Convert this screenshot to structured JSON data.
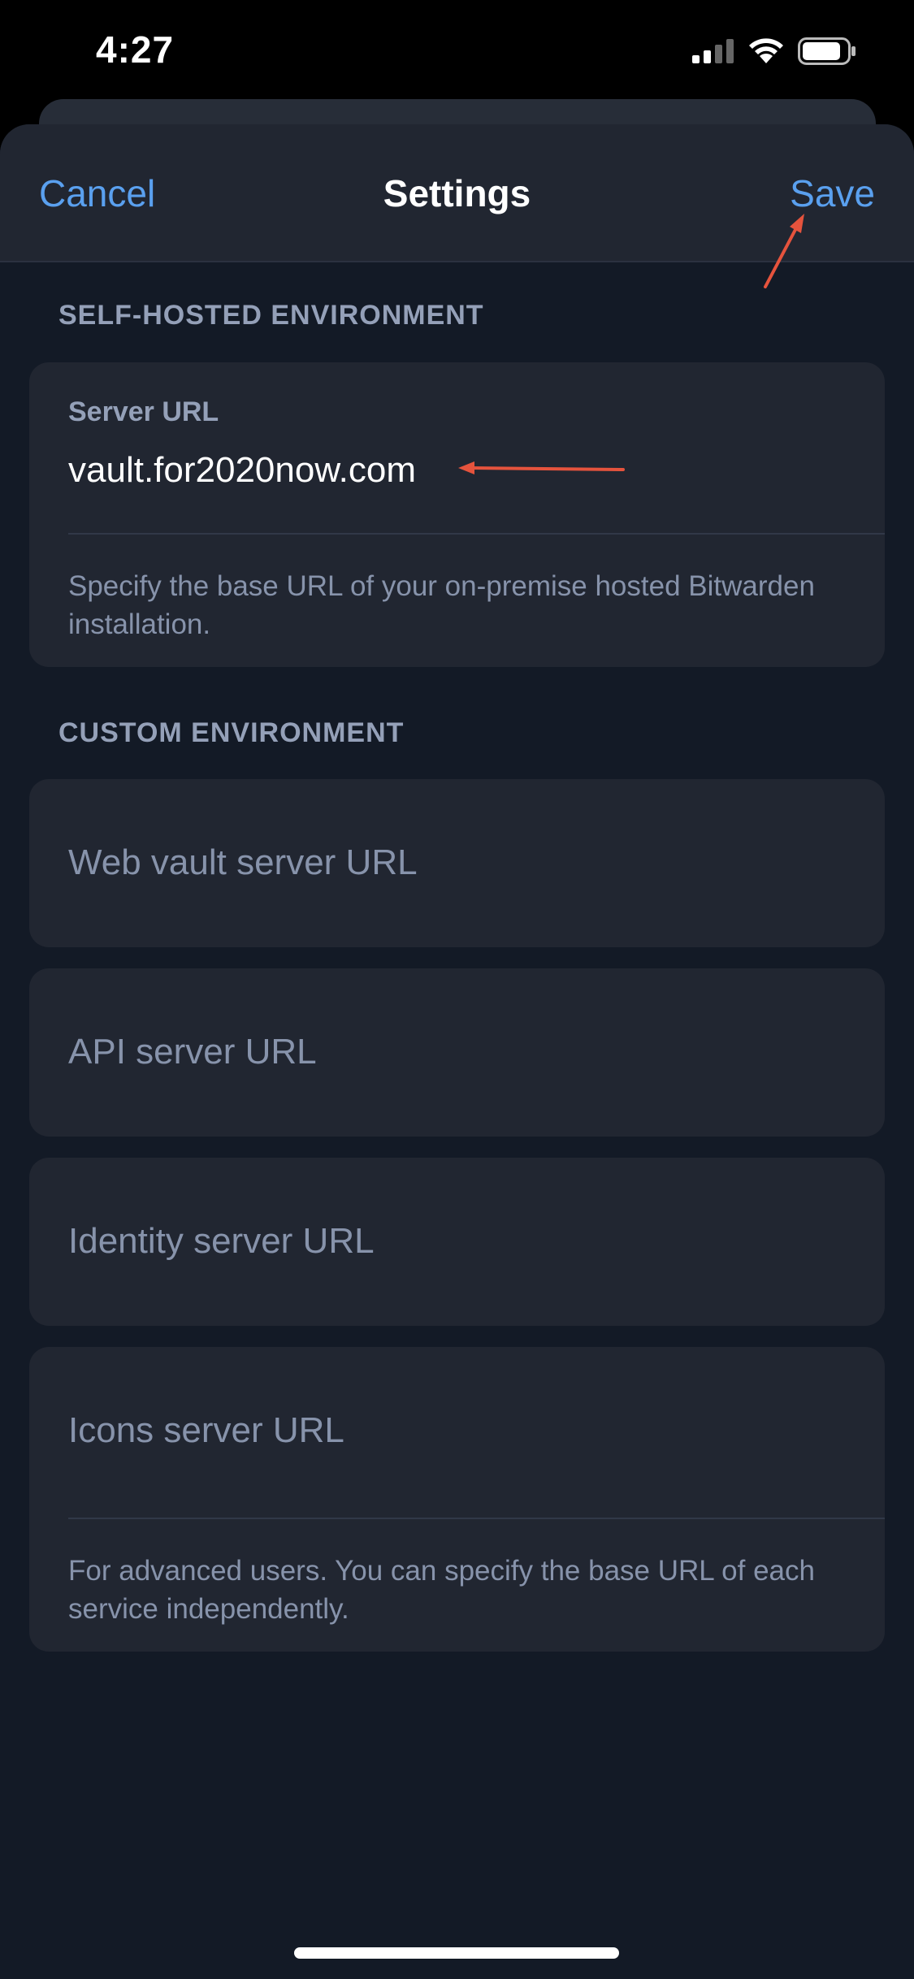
{
  "status_bar": {
    "time": "4:27"
  },
  "nav": {
    "cancel_label": "Cancel",
    "title": "Settings",
    "save_label": "Save"
  },
  "self_hosted": {
    "section_title": "SELF-HOSTED ENVIRONMENT",
    "server_url_label": "Server URL",
    "server_url_value": "vault.for2020now.com",
    "hint": "Specify the base URL of your on-premise hosted Bitwarden installation."
  },
  "custom": {
    "section_title": "CUSTOM ENVIRONMENT",
    "web_vault_placeholder": "Web vault server URL",
    "api_placeholder": "API server URL",
    "identity_placeholder": "Identity server URL",
    "icons_placeholder": "Icons server URL",
    "hint": "For advanced users. You can specify the base URL of each service independently."
  },
  "colors": {
    "accent": "#5aa0ef",
    "annotation_arrow": "#e5533d",
    "background": "#131a26",
    "card": "#212631"
  }
}
